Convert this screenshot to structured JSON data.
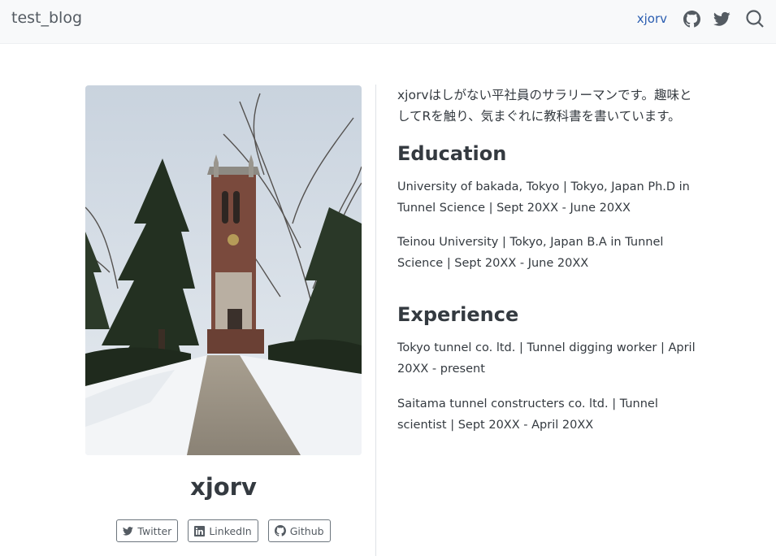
{
  "navbar": {
    "brand": "test_blog",
    "user_link": "xjorv",
    "icons": [
      "github-icon",
      "twitter-icon",
      "search-icon"
    ]
  },
  "profile": {
    "name": "xjorv",
    "photo_icon": "tower-photo",
    "links": [
      {
        "label": "Twitter",
        "icon": "twitter-icon"
      },
      {
        "label": "LinkedIn",
        "icon": "linkedin-icon"
      },
      {
        "label": "Github",
        "icon": "github-icon"
      }
    ]
  },
  "about": {
    "intro": "xjorvはしがない平社員のサラリーマンです。趣味としてRを触り、気まぐれに教科書を書いています。",
    "education_title": "Education",
    "education": [
      "University of bakada, Tokyo | Tokyo, Japan Ph.D in Tunnel Science | Sept 20XX - June 20XX",
      "Teinou University | Tokyo, Japan B.A in Tunnel Science | Sept 20XX - June 20XX"
    ],
    "experience_title": "Experience",
    "experience": [
      "Tokyo tunnel co. ltd. | Tunnel digging worker | April 20XX - present",
      "Saitama tunnel constructers co. ltd. | Tunnel scientist | Sept 20XX - April 20XX"
    ]
  },
  "colors": {
    "navbar_bg": "#f8f9fa",
    "link": "#2a5db0",
    "text": "#343a40",
    "muted": "#545b62"
  }
}
